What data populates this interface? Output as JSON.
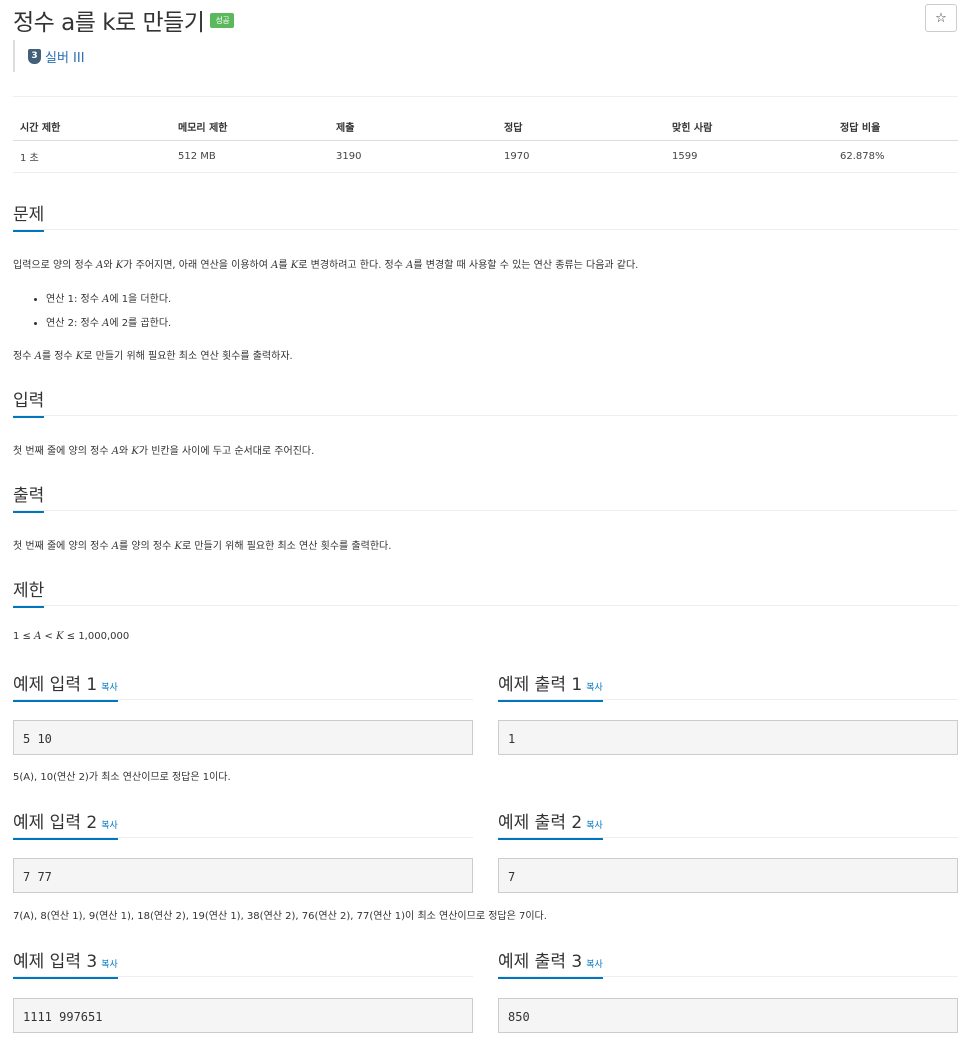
{
  "header": {
    "title": "정수 a를 k로 만들기",
    "badge": "성공",
    "star": "☆",
    "tier_num": "3",
    "tier": "실버 III"
  },
  "stats": {
    "headers": [
      "시간 제한",
      "메모리 제한",
      "제출",
      "정답",
      "맞힌 사람",
      "정답 비율"
    ],
    "values": [
      "1 초",
      "512 MB",
      "3190",
      "1970",
      "1599",
      "62.878%"
    ]
  },
  "sections": {
    "problem": "문제",
    "input": "입력",
    "output": "출력",
    "limit": "제한"
  },
  "problem": {
    "desc_parts": [
      "입력으로 양의 정수 ",
      "A",
      "와 ",
      "K",
      "가 주어지면, 아래 연산을 이용하여 ",
      "A",
      "를 ",
      "K",
      "로 변경하려고 한다. 정수 ",
      "A",
      "를 변경할 때 사용할 수 있는 연산 종류는 다음과 같다."
    ],
    "op1": [
      "연산 1: 정수 ",
      "A",
      "에 1을 더한다."
    ],
    "op2": [
      "연산 2: 정수 ",
      "A",
      "에 2를 곱한다."
    ],
    "goal": [
      "정수 ",
      "A",
      "를 정수 ",
      "K",
      "로 만들기 위해 필요한 최소 연산 횟수를 출력하자."
    ]
  },
  "input_desc": [
    "첫 번째 줄에 양의 정수 ",
    "A",
    "와 ",
    "K",
    "가 빈칸을 사이에 두고 순서대로 주어진다."
  ],
  "output_desc": [
    "첫 번째 줄에 양의 정수 ",
    "A",
    "를 양의 정수 ",
    "K",
    "로 만들기 위해 필요한 최소 연산 횟수를 출력한다."
  ],
  "limit_desc": [
    "1 ≤ ",
    "A",
    " < ",
    "K",
    " ≤ 1,000,000"
  ],
  "copy_label": "복사",
  "samples": [
    {
      "in_title": "예제 입력 1",
      "out_title": "예제 출력 1",
      "input": "5 10",
      "output": "1",
      "note": "5(A), 10(연산 2)가 최소 연산이므로 정답은 1이다."
    },
    {
      "in_title": "예제 입력 2",
      "out_title": "예제 출력 2",
      "input": "7 77",
      "output": "7",
      "note": "7(A), 8(연산 1), 9(연산 1), 18(연산 2), 19(연산 1), 38(연산 2), 76(연산 2), 77(연산 1)이 최소 연산이므로 정답은 7이다."
    },
    {
      "in_title": "예제 입력 3",
      "out_title": "예제 출력 3",
      "input": "1111 997651",
      "output": "850"
    }
  ]
}
